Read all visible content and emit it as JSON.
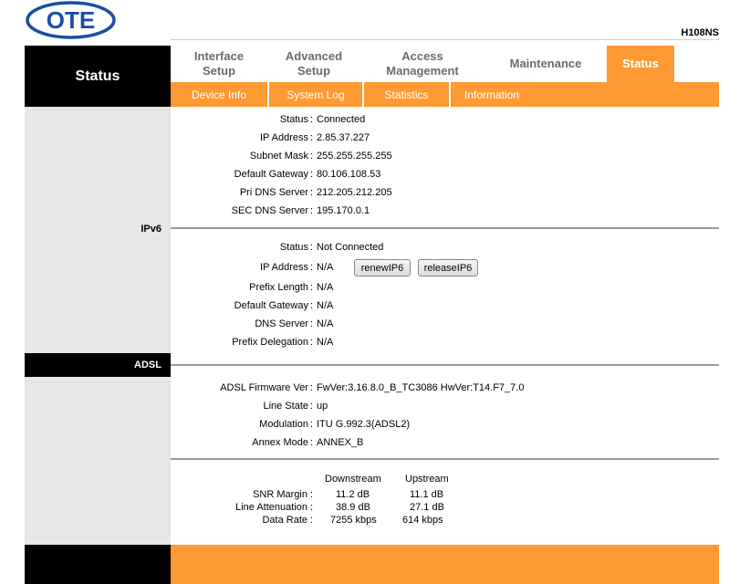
{
  "brand": {
    "logo_text": "OTE",
    "model": "H108NS",
    "logo_color": "#1a4fa0"
  },
  "left_title": "Status",
  "tabs": [
    {
      "label": "Interface Setup",
      "active": false
    },
    {
      "label": "Advanced Setup",
      "active": false
    },
    {
      "label": "Access Management",
      "active": false
    },
    {
      "label": "Maintenance",
      "active": false
    },
    {
      "label": "Status",
      "active": true
    }
  ],
  "subnav": [
    "Device Info",
    "System Log",
    "Statistics",
    "Information"
  ],
  "accent_color": "#ff9933",
  "wan": {
    "status": {
      "label": "Status",
      "value": "Connected"
    },
    "ip": {
      "label": "IP Address",
      "value": "2.85.37.227"
    },
    "mask": {
      "label": "Subnet Mask",
      "value": "255.255.255.255"
    },
    "gateway": {
      "label": "Default Gateway",
      "value": "80.106.108.53"
    },
    "pri_dns": {
      "label": "Pri DNS Server",
      "value": "212.205.212.205"
    },
    "sec_dns": {
      "label": "SEC DNS Server",
      "value": "195.170.0.1"
    }
  },
  "ipv6": {
    "section_label": "IPv6",
    "status": {
      "label": "Status",
      "value": "Not Connected"
    },
    "ip": {
      "label": "IP Address",
      "value": "N/A"
    },
    "prefix_len": {
      "label": "Prefix Length",
      "value": "N/A"
    },
    "gateway": {
      "label": "Default Gateway",
      "value": "N/A"
    },
    "dns": {
      "label": "DNS Server",
      "value": "N/A"
    },
    "prefix_del": {
      "label": "Prefix Delegation",
      "value": "N/A"
    },
    "renew_label": "renewIP6",
    "release_label": "releaseIP6"
  },
  "adsl": {
    "section_label": "ADSL",
    "fw": {
      "label": "ADSL Firmware Ver",
      "value": "FwVer:3.16.8.0_B_TC3086 HwVer:T14.F7_7.0"
    },
    "line_state": {
      "label": "Line State",
      "value": "up"
    },
    "modulation": {
      "label": "Modulation",
      "value": "ITU G.992.3(ADSL2)"
    },
    "annex": {
      "label": "Annex Mode",
      "value": "ANNEX_B"
    }
  },
  "stats": {
    "col_down": "Downstream",
    "col_up": "Upstream",
    "snr": {
      "label": "SNR Margin",
      "down": "11.2 dB",
      "up": "11.1 dB"
    },
    "atten": {
      "label": "Line Attenuation",
      "down": "38.9 dB",
      "up": "27.1 dB"
    },
    "rate": {
      "label": "Data Rate",
      "down": "7255 kbps",
      "up": "614 kbps"
    }
  }
}
